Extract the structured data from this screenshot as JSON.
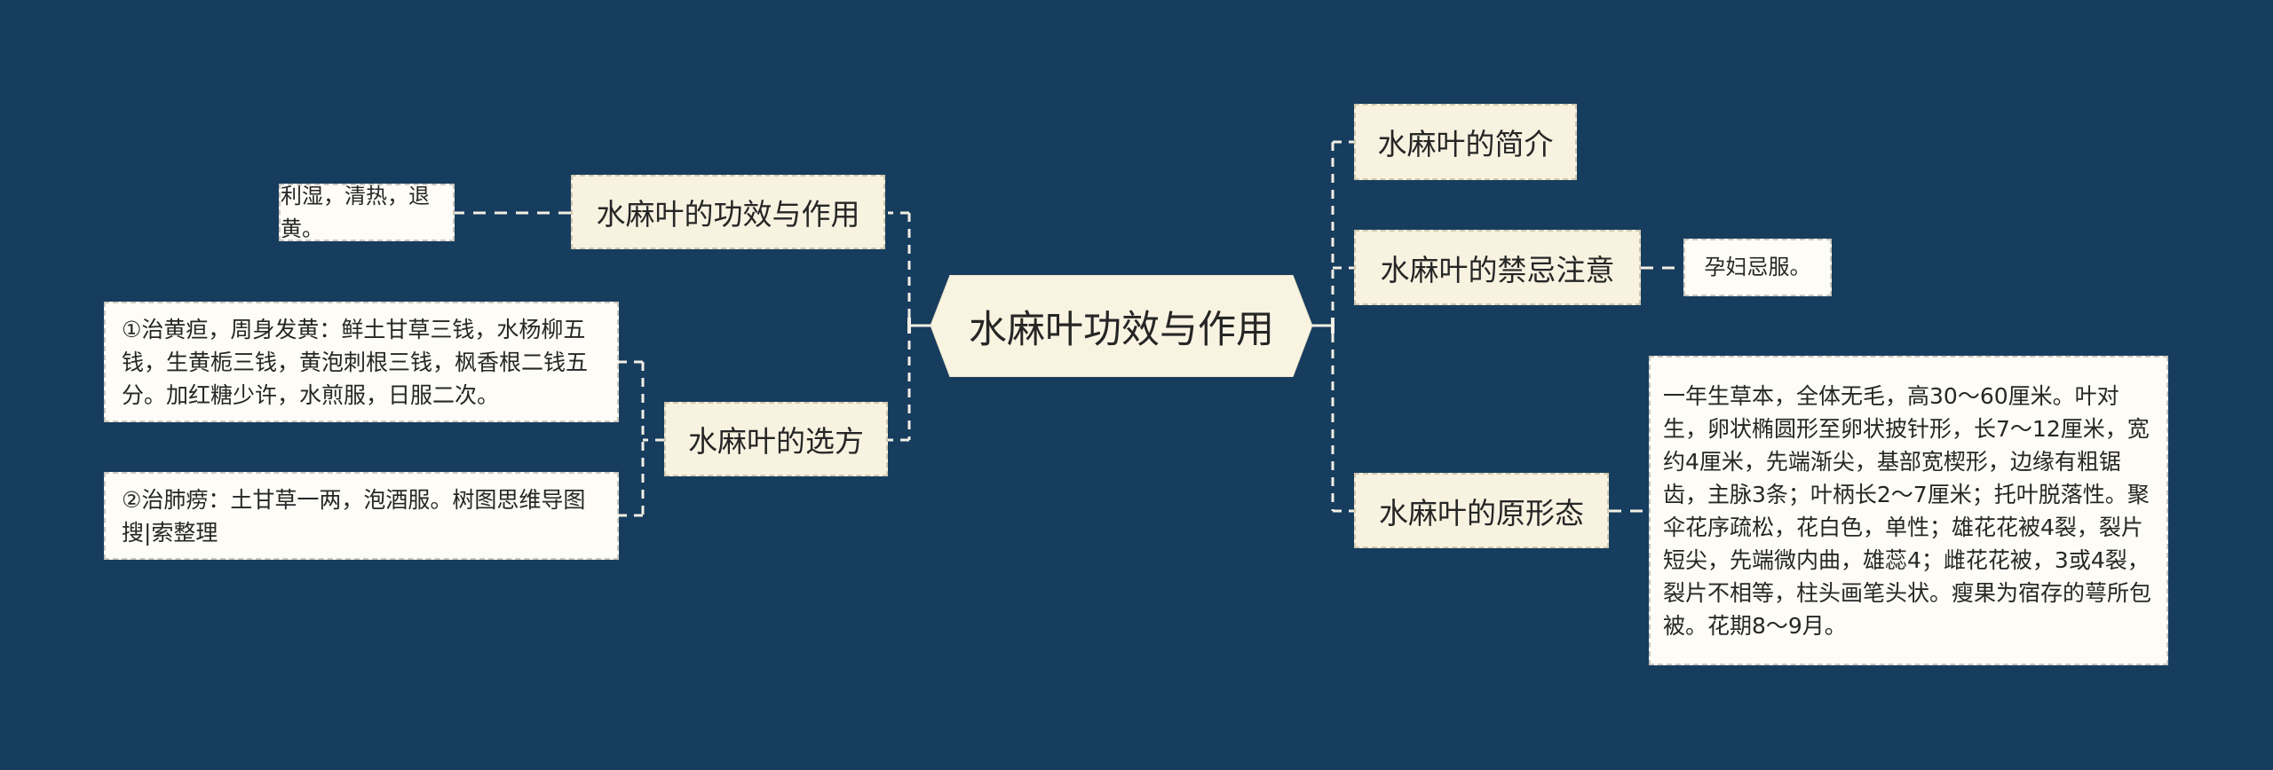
{
  "central_topic": {
    "label": "水麻叶功效与作用",
    "fill_color": "#f9f4e2"
  },
  "background_color": "#173d5e",
  "left_branches": [
    {
      "label": "水麻叶的功效与作用",
      "children": [
        "利湿，清热，退黄。"
      ]
    },
    {
      "label": "水麻叶的选方",
      "children": [
        "①治黄疸，周身发黄：鲜土甘草三钱，水杨柳五钱，生黄栀三钱，黄泡刺根三钱，枫香根二钱五分。加红糖少许，水煎服，日服二次。",
        "②治肺痨：土甘草一两，泡酒服。树图思维导图搜|索整理"
      ]
    }
  ],
  "right_branches": [
    {
      "label": "水麻叶的简介",
      "children": []
    },
    {
      "label": "水麻叶的禁忌注意",
      "children": [
        "孕妇忌服。"
      ]
    },
    {
      "label": "水麻叶的原形态",
      "children": [
        "一年生草本，全体无毛，高30～60厘米。叶对生，卵状椭圆形至卵状披针形，长7～12厘米，宽约4厘米，先端渐尖，基部宽楔形，边缘有粗锯齿，主脉3条；叶柄长2～7厘米；托叶脱落性。聚伞花序疏松，花白色，单性；雄花花被4裂，裂片短尖，先端微内曲，雄蕊4；雌花花被，3或4裂，裂片不相等，柱头画笔头状。瘦果为宿存的萼所包被。花期8～9月。"
      ]
    }
  ]
}
